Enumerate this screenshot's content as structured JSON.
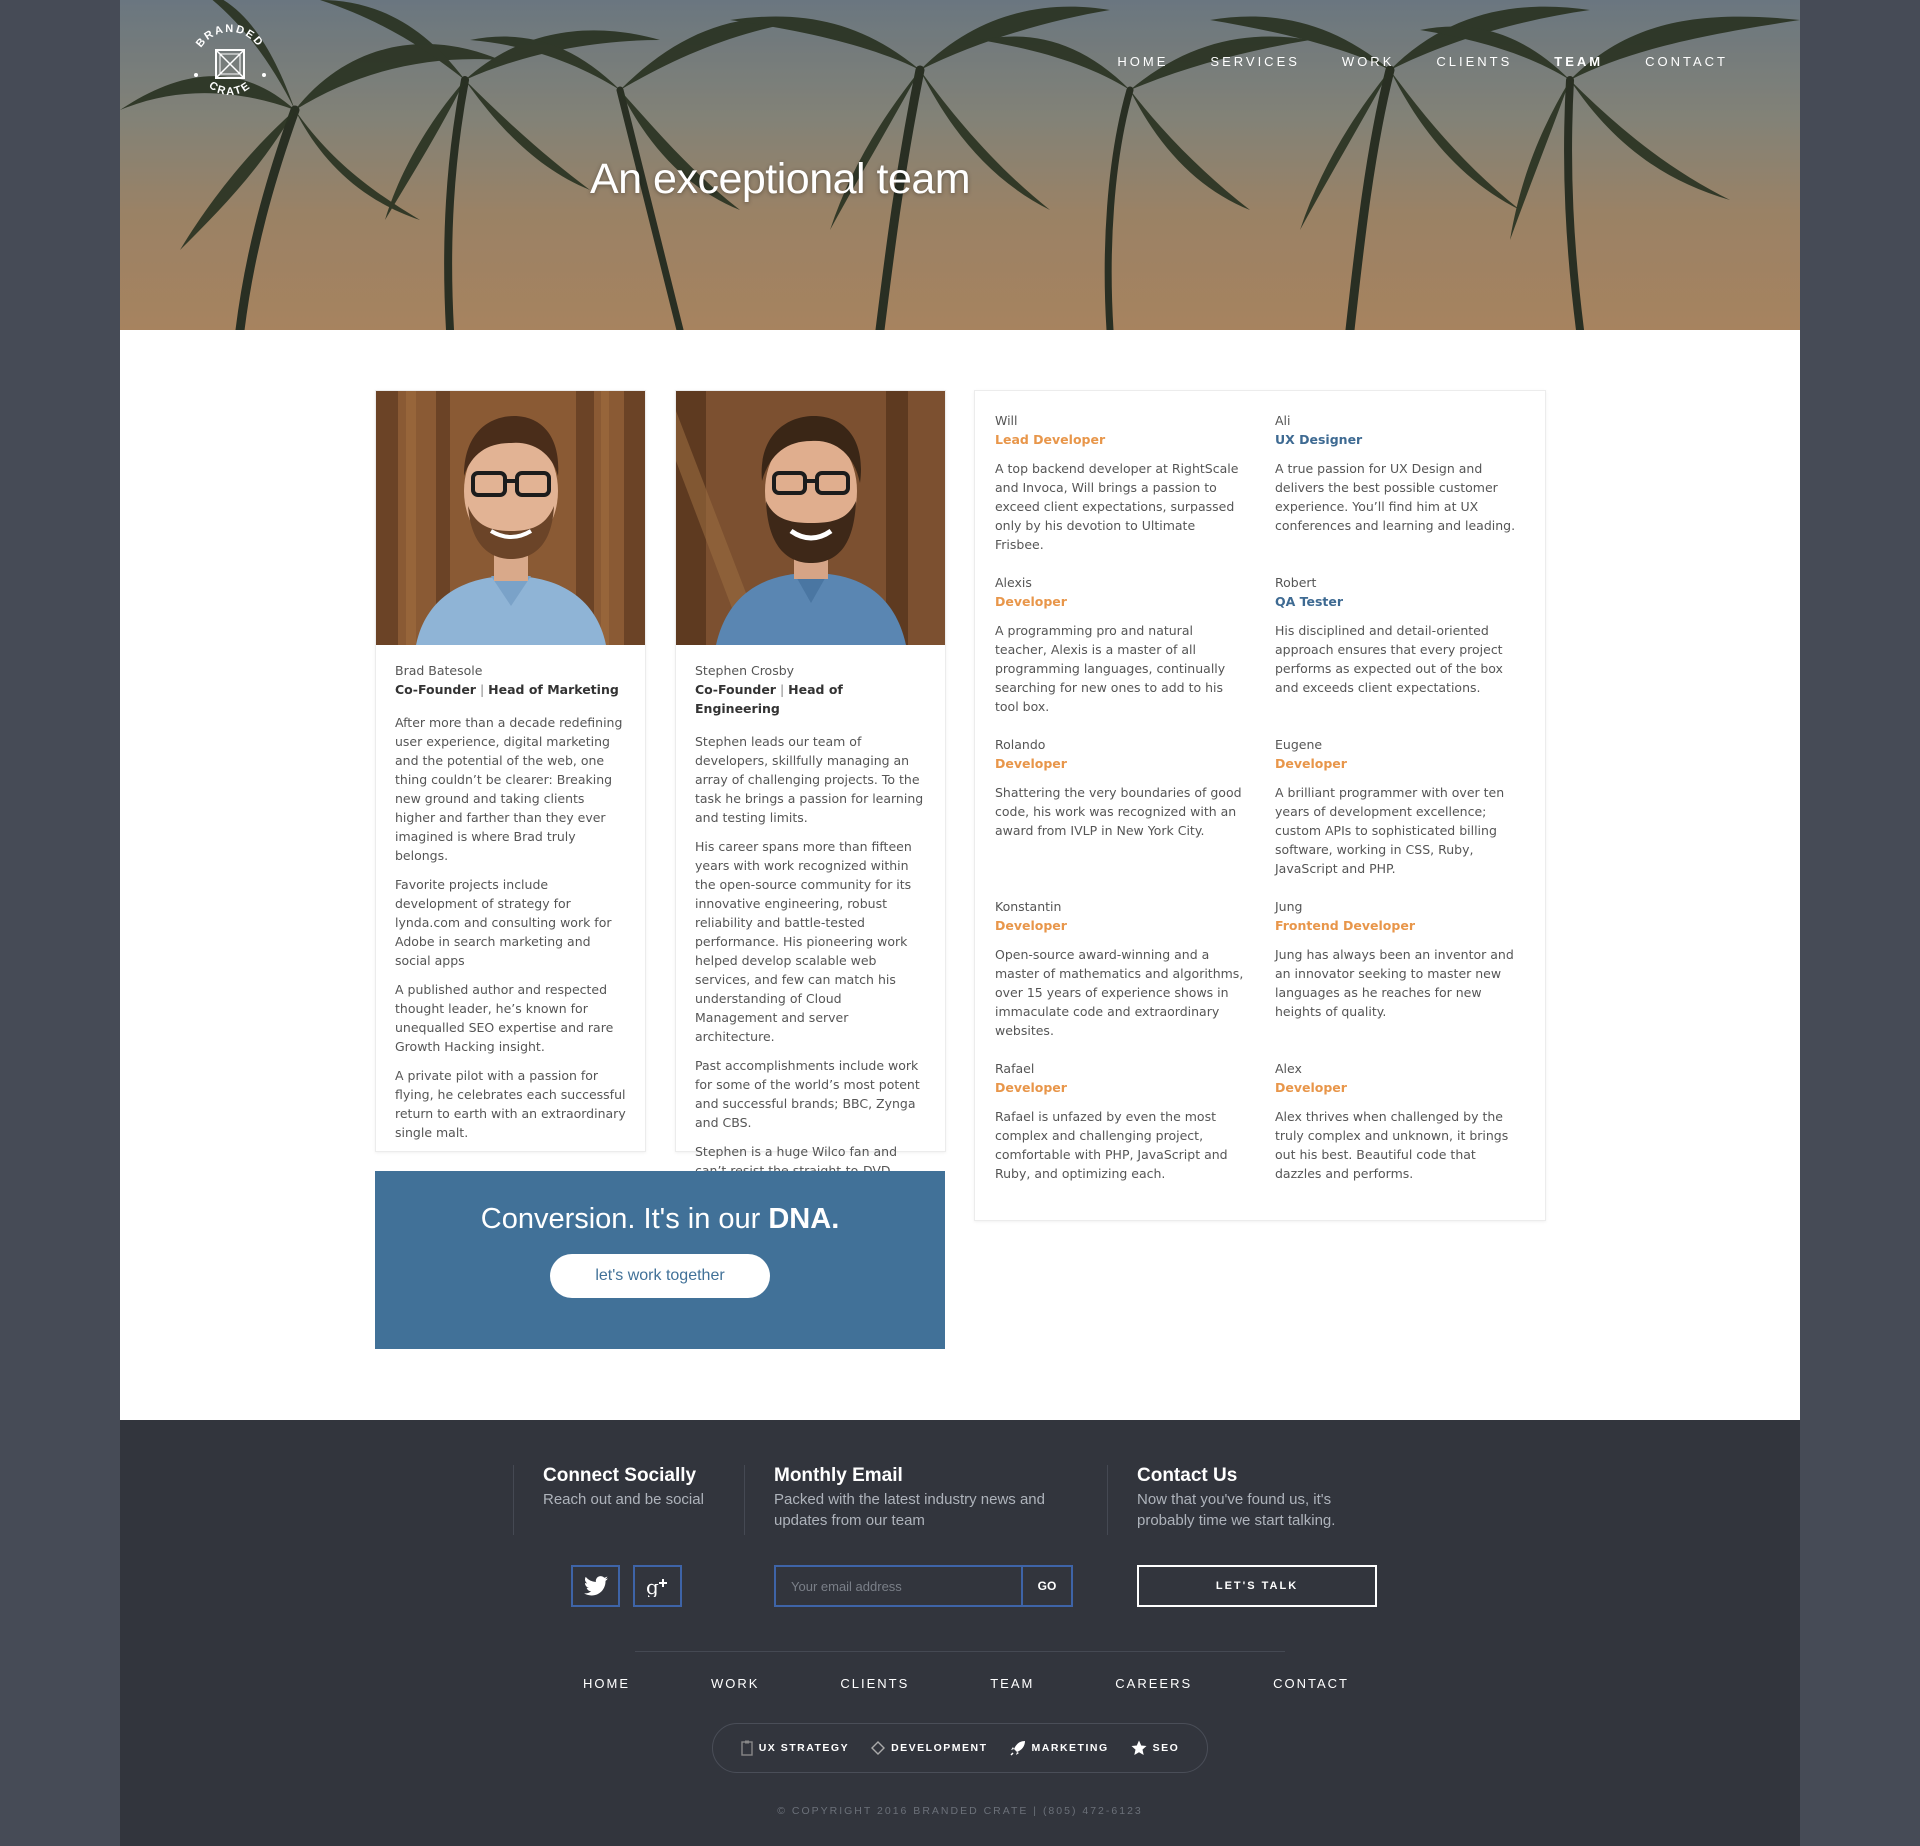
{
  "brand": {
    "logo_line1": "BRANDED",
    "logo_line2": "CRATE"
  },
  "nav": {
    "items": [
      {
        "label": "HOME"
      },
      {
        "label": "SERVICES"
      },
      {
        "label": "WORK"
      },
      {
        "label": "CLIENTS"
      },
      {
        "label": "TEAM",
        "active": true
      },
      {
        "label": "CONTACT"
      }
    ]
  },
  "hero": {
    "title": "An exceptional team"
  },
  "profiles": [
    {
      "name": "Brad Batesole",
      "role_a": "Co-Founder",
      "sep": " | ",
      "role_b": "Head of Marketing",
      "paragraphs": [
        "After more than a decade redefining user experience, digital marketing and the potential of the web, one thing couldn’t be clearer: Breaking new ground and taking clients higher and farther than they ever imagined is where Brad truly belongs.",
        "Favorite projects include development of strategy for lynda.com and consulting work for Adobe in search marketing and social apps",
        "A published author and respected thought leader, he’s known for unequalled SEO expertise and rare Growth Hacking insight.",
        "A private pilot with a passion for flying, he celebrates each successful return to earth with an extraordinary single malt."
      ]
    },
    {
      "name": "Stephen Crosby",
      "role_a": "Co-Founder",
      "sep": " | ",
      "role_b": "Head of Engineering",
      "paragraphs": [
        "Stephen leads our team of developers, skillfully managing an array of challenging projects. To the task he brings a passion for learning and testing limits.",
        "His career spans more than fifteen years with work recognized within the open-source community for its innovative engineering, robust reliability and battle-tested performance. His pioneering work helped develop scalable web services, and few can match his understanding of Cloud Management and server architecture.",
        "Past accomplishments include work for some of the world’s most potent and successful brands; BBC, Zynga and CBS.",
        "Stephen is a huge Wilco fan and can’t resist the straight-to-DVD."
      ]
    }
  ],
  "team": [
    {
      "name": "Will",
      "role": "Lead Developer",
      "color": "#e8964a",
      "desc": "A top backend developer at RightScale and Invoca, Will brings a passion to exceed client expectations, surpassed only by his devotion to Ultimate Frisbee."
    },
    {
      "name": "Ali",
      "role": "UX Designer",
      "color": "#3e6a92",
      "desc": "A true passion for UX Design and delivers the best possible customer experience. You’ll find him at UX conferences and learning and leading."
    },
    {
      "name": "Alexis",
      "role": "Developer",
      "color": "#e8964a",
      "desc": "A programming pro and natural teacher, Alexis is a master of all programming languages, continually searching for new ones to add to his tool box."
    },
    {
      "name": "Robert",
      "role": "QA Tester",
      "color": "#3e6a92",
      "desc": "His disciplined and detail-oriented approach ensures that every project performs as expected out of the box and exceeds client expectations."
    },
    {
      "name": "Rolando",
      "role": "Developer",
      "color": "#e8964a",
      "desc": "Shattering the very boundaries of good code, his work was recognized with an award from IVLP in New York City."
    },
    {
      "name": "Eugene",
      "role": "Developer",
      "color": "#e8964a",
      "desc": "A brilliant programmer with over ten years of development excellence; custom APIs to sophisticated billing software, working in CSS, Ruby, JavaScript and PHP."
    },
    {
      "name": "Konstantin",
      "role": "Developer",
      "color": "#e8964a",
      "desc": "Open-source award-winning and a master of mathematics and algorithms, over 15 years of experience shows in immaculate code and extraordinary websites."
    },
    {
      "name": "Jung",
      "role": "Frontend Developer",
      "color": "#e8964a",
      "desc": "Jung has always been an inventor and an innovator seeking to master new languages as he reaches for new heights of quality."
    },
    {
      "name": "Rafael",
      "role": "Developer",
      "color": "#e8964a",
      "desc": "Rafael is unfazed by even the most complex and challenging project, comfortable with PHP, JavaScript and Ruby, and optimizing each."
    },
    {
      "name": "Alex",
      "role": "Developer",
      "color": "#e8964a",
      "desc": "Alex thrives when challenged by the truly complex and unknown, it brings out his best. Beautiful code that dazzles and performs."
    }
  ],
  "cta": {
    "text_light": "Conversion. It's in our ",
    "text_bold": "DNA.",
    "button": "let's work together"
  },
  "footer": {
    "social": {
      "title": "Connect Socially",
      "subtitle": "Reach out and be social",
      "icons": [
        "twitter-icon",
        "google-plus-icon"
      ]
    },
    "email": {
      "title": "Monthly Email",
      "subtitle": "Packed with the latest industry news and updates from our team",
      "placeholder": "Your email address",
      "button": "GO"
    },
    "contact": {
      "title": "Contact Us",
      "subtitle": "Now that you've found us, it's probably time we start talking.",
      "button": "LET'S TALK"
    },
    "nav": [
      "HOME",
      "WORK",
      "CLIENTS",
      "TEAM",
      "CAREERS",
      "CONTACT"
    ],
    "services": [
      {
        "label": "UX STRATEGY",
        "icon": "clipboard-icon"
      },
      {
        "label": "DEVELOPMENT",
        "icon": "code-icon"
      },
      {
        "label": "MARKETING",
        "icon": "rocket-icon"
      },
      {
        "label": "SEO",
        "icon": "star-icon"
      }
    ],
    "copyright": "© COPYRIGHT 2016 BRANDED CRATE | (805) 472-6123"
  },
  "colors": {
    "accent_blue": "#417198",
    "role_orange": "#e8964a",
    "role_blue": "#3e6a92",
    "footer_bg": "#32353d",
    "outer_bg": "#464b56"
  }
}
